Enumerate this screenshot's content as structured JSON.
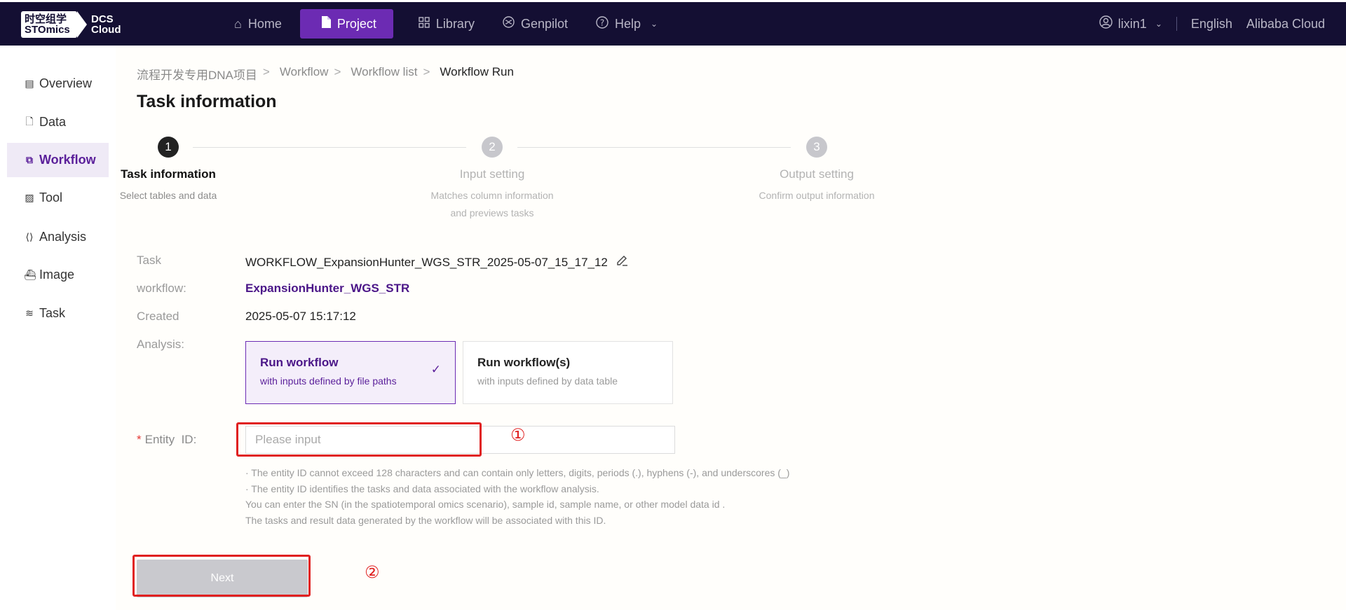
{
  "brand": {
    "logo_cn": "时空组学",
    "logo_en": "STOmics",
    "product_line1": "DCS",
    "product_line2": "Cloud"
  },
  "nav": {
    "home": "Home",
    "project": "Project",
    "library": "Library",
    "genpilot": "Genpilot",
    "help": "Help"
  },
  "user": {
    "name": "lixin1",
    "language": "English",
    "provider": "Alibaba Cloud"
  },
  "sidebar": {
    "items": [
      {
        "label": "Overview"
      },
      {
        "label": "Data"
      },
      {
        "label": "Workflow"
      },
      {
        "label": "Tool"
      },
      {
        "label": "Analysis"
      },
      {
        "label": "Image"
      },
      {
        "label": "Task"
      }
    ]
  },
  "breadcrumb": {
    "project": "流程开发专用DNA项目",
    "workflow": "Workflow",
    "list": "Workflow list",
    "current": "Workflow Run",
    "separator": ">"
  },
  "page": {
    "title": "Task information"
  },
  "steps": [
    {
      "number": "1",
      "title": "Task information",
      "desc": [
        "Select tables and data"
      ]
    },
    {
      "number": "2",
      "title": "Input setting",
      "desc": [
        "Matches column information",
        "and previews tasks"
      ]
    },
    {
      "number": "3",
      "title": "Output setting",
      "desc": [
        "Confirm output information"
      ]
    }
  ],
  "fields": {
    "task_label": "Task",
    "task_value": "WORKFLOW_ExpansionHunter_WGS_STR_2025-05-07_15_17_12",
    "workflow_label": "workflow:",
    "workflow_value": "ExpansionHunter_WGS_STR",
    "created_label": "Created",
    "created_value": "2025-05-07 15:17:12",
    "analysis_label": "Analysis:"
  },
  "cards": {
    "file_paths": {
      "title": "Run workflow",
      "sub": "with inputs defined by file paths"
    },
    "data_table": {
      "title": "Run workflow(s)",
      "sub": "with inputs defined by data table"
    }
  },
  "entity": {
    "required_mark": "*",
    "label": "Entity  ID:",
    "placeholder": "Please input",
    "value": ""
  },
  "hints": [
    "· The entity ID cannot exceed 128 characters and can contain only letters, digits, periods (.), hyphens (-), and underscores (_)",
    "· The entity ID identifies the tasks and data associated with the workflow analysis.",
    "You can enter the SN (in the spatiotemporal omics scenario), sample id, sample name, or other model data id .",
    "The tasks and result data generated by the workflow will be associated with this ID."
  ],
  "buttons": {
    "next": "Next"
  },
  "annotations": {
    "marker1": "①",
    "marker2": "②"
  }
}
